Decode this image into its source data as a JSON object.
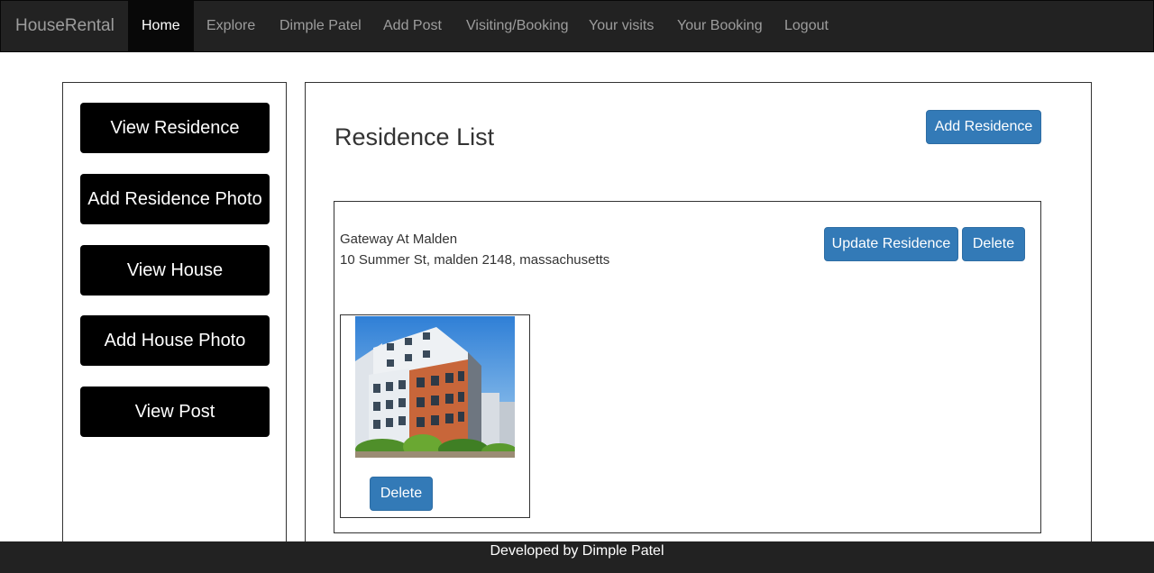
{
  "navbar": {
    "brand": "HouseRental",
    "items": [
      {
        "label": "Home",
        "active": true
      },
      {
        "label": "Explore"
      },
      {
        "label": "Dimple Patel"
      },
      {
        "label": "Add Post"
      },
      {
        "label": "Visiting/Booking"
      },
      {
        "label": "Your visits"
      },
      {
        "label": "Your Booking"
      },
      {
        "label": "Logout"
      }
    ]
  },
  "sidebar": {
    "buttons": [
      {
        "label": "View Residence"
      },
      {
        "label": "Add Residence Photo"
      },
      {
        "label": "View House"
      },
      {
        "label": "Add House Photo"
      },
      {
        "label": "View Post"
      }
    ]
  },
  "main": {
    "title": "Residence List",
    "add_button": "Add Residence",
    "residence": {
      "name": "Gateway At Malden",
      "address": "10 Summer St, malden 2148, massachusetts",
      "update_button": "Update Residence",
      "delete_button": "Delete",
      "photo_delete_button": "Delete"
    }
  },
  "footer": {
    "text": "Developed by Dimple Patel"
  },
  "colors": {
    "navbar_bg": "#222222",
    "primary": "#337ab7",
    "sidebar_button": "#000000"
  }
}
